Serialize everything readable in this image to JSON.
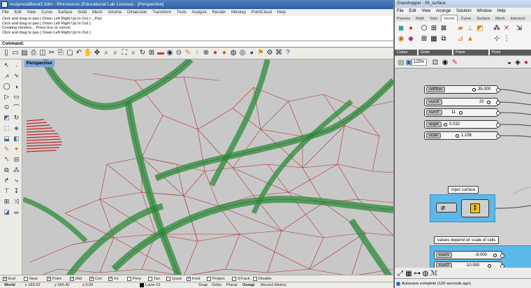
{
  "rhino": {
    "title": "reciprocalBend3.3dm - Rhinoceros (Educational Lab License) - [Perspective]",
    "menu": [
      "File",
      "Edit",
      "View",
      "Curve",
      "Surface",
      "Solid",
      "Mesh",
      "Volume",
      "Dimension",
      "Transform",
      "Tools",
      "Analyze",
      "Render",
      "Monkey",
      "PointCloud",
      "Help"
    ],
    "command_history": [
      "Click and drag to pan ( Down Left Right Up In Out ): _Pan",
      "Click and drag to pan ( Down Left Right Up In Out ):",
      "Creating meshes... Press Esc to cancel",
      "Click and drag to pan ( Down Left Right Up In Out ):"
    ],
    "command_prompt": "Command:",
    "viewport_label": "Perspective",
    "osnaps": [
      {
        "label": "End",
        "checked": true
      },
      {
        "label": "Near",
        "checked": false
      },
      {
        "label": "Point",
        "checked": true
      },
      {
        "label": "Mid",
        "checked": true
      },
      {
        "label": "Cen",
        "checked": true
      },
      {
        "label": "Int",
        "checked": true
      },
      {
        "label": "Perp",
        "checked": false
      },
      {
        "label": "Tan",
        "checked": false
      },
      {
        "label": "Quad",
        "checked": false
      },
      {
        "label": "Knot",
        "checked": true
      },
      {
        "label": "Project",
        "checked": false
      },
      {
        "label": "STrack",
        "checked": false
      },
      {
        "label": "Disable",
        "checked": false
      }
    ],
    "status": {
      "cplane": "World",
      "x": "x 183.02",
      "y": "y 345.40",
      "z": "z 0.00",
      "layer": "Layer 01",
      "snap": "Snap",
      "ortho": "Ortho",
      "planar": "Planar",
      "osnap": "Osnap",
      "record": "Record History"
    }
  },
  "grasshopper": {
    "title": "Grasshopper - 06_surface",
    "menu": [
      "File",
      "Edit",
      "View",
      "Arrange",
      "Solution",
      "Window",
      "Help"
    ],
    "tabs": [
      "Params",
      "Math",
      "Sets",
      "Vector",
      "Curve",
      "Surface",
      "Mesh",
      "Intersect"
    ],
    "active_tab": "Vector",
    "ribbon_groups": [
      "Colour",
      "Grids",
      "Plane",
      "Point"
    ],
    "zoom": "125%",
    "sliders": [
      {
        "name": "cellSize",
        "value": "35.000"
      },
      {
        "name": "numX",
        "value": "20"
      },
      {
        "name": "numY",
        "value": "11"
      },
      {
        "name": "angle",
        "value": "0.032"
      },
      {
        "name": "scale",
        "value": "1.156"
      }
    ],
    "group_input_surface": "input surface",
    "group_values": "values depend on scale of cells",
    "inset_sliders": [
      {
        "name": "inset1",
        "value": "-8.000"
      },
      {
        "name": "inset2",
        "value": "-10.000"
      }
    ],
    "status": "Autosave complete (120 seconds ago)"
  }
}
